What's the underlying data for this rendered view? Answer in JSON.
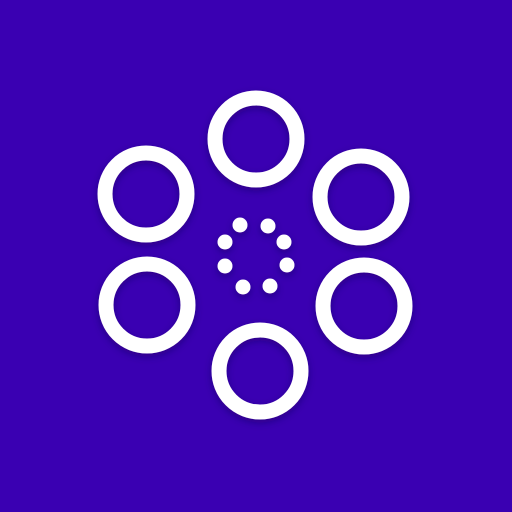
{
  "colors": {
    "background": "#3a00b2",
    "foreground": "#ffffff"
  },
  "icon": "flower-dots-logo-icon"
}
